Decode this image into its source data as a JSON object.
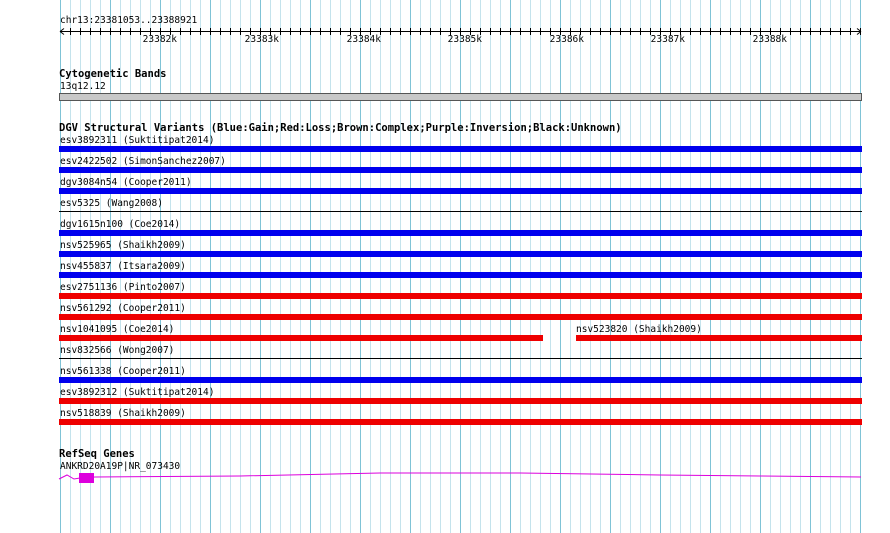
{
  "ruler": {
    "locus": "chr13:23381053..23388921",
    "ticks": [
      "23382k",
      "23383k",
      "23384k",
      "23385k",
      "23386k",
      "23387k",
      "23388k"
    ]
  },
  "cytoband": {
    "title": "Cytogenetic Bands",
    "band": "13q12.12"
  },
  "dgv": {
    "title": "DGV Structural Variants (Blue:Gain;Red:Loss;Brown:Complex;Purple:Inversion;Black:Unknown)",
    "colors": {
      "gain": "#0000ee",
      "loss": "#ee0000",
      "unknown": "#000000"
    },
    "rows": [
      {
        "features": [
          {
            "label": "esv3892311 (Suktitipat2014)",
            "type": "gain"
          }
        ]
      },
      {
        "features": [
          {
            "label": "esv2422502 (SimonSanchez2007)",
            "type": "gain"
          }
        ]
      },
      {
        "features": [
          {
            "label": "dgv3084n54 (Cooper2011)",
            "type": "gain"
          }
        ]
      },
      {
        "features": [
          {
            "label": "esv5325 (Wang2008)",
            "type": "unknown"
          }
        ]
      },
      {
        "features": [
          {
            "label": "dgv1615n100 (Coe2014)",
            "type": "gain"
          }
        ]
      },
      {
        "features": [
          {
            "label": "nsv525965 (Shaikh2009)",
            "type": "gain"
          }
        ]
      },
      {
        "features": [
          {
            "label": "nsv455837 (Itsara2009)",
            "type": "gain"
          }
        ]
      },
      {
        "features": [
          {
            "label": "esv2751136 (Pinto2007)",
            "type": "loss"
          }
        ]
      },
      {
        "features": [
          {
            "label": "nsv561292 (Cooper2011)",
            "type": "loss"
          }
        ]
      },
      {
        "features": [
          {
            "label": "nsv1041095 (Coe2014)",
            "type": "loss"
          },
          {
            "label": "nsv523820 (Shaikh2009)",
            "type": "loss"
          }
        ]
      },
      {
        "features": [
          {
            "label": "nsv832566 (Wong2007)",
            "type": "unknown"
          }
        ]
      },
      {
        "features": [
          {
            "label": "nsv561338 (Cooper2011)",
            "type": "gain"
          }
        ]
      },
      {
        "features": [
          {
            "label": "esv3892312 (Suktitipat2014)",
            "type": "loss"
          }
        ]
      },
      {
        "features": [
          {
            "label": "nsv518839 (Shaikh2009)",
            "type": "loss"
          }
        ]
      }
    ]
  },
  "refseq": {
    "title": "RefSeq Genes",
    "gene_label": "ANKRD20A19P|NR_073430",
    "color": "#dd00dd"
  }
}
